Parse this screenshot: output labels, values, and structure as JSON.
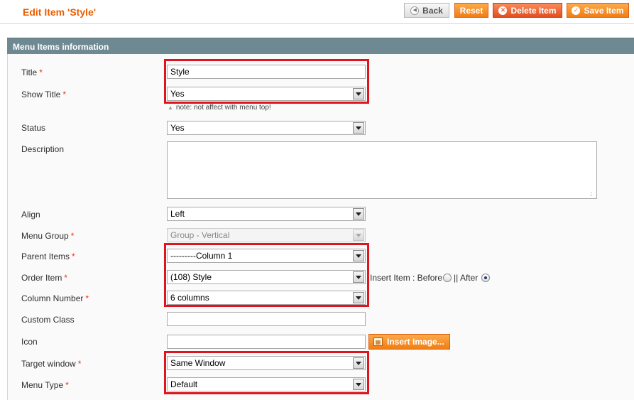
{
  "header": {
    "title": "Edit Item 'Style'",
    "buttons": {
      "back": "Back",
      "reset": "Reset",
      "delete": "Delete Item",
      "save": "Save Item"
    }
  },
  "section": {
    "title": "Menu Items information"
  },
  "form": {
    "title": {
      "label": "Title",
      "required": "*",
      "value": "Style"
    },
    "show_title": {
      "label": "Show Title",
      "required": "*",
      "value": "Yes",
      "note": "note: not affect with menu top!"
    },
    "status": {
      "label": "Status",
      "value": "Yes"
    },
    "description": {
      "label": "Description",
      "value": ""
    },
    "align": {
      "label": "Align",
      "value": "Left"
    },
    "menu_group": {
      "label": "Menu Group",
      "required": "*",
      "value": "Group - Vertical",
      "disabled": true
    },
    "parent_items": {
      "label": "Parent Items",
      "required": "*",
      "value": "---------Column 1"
    },
    "order_item": {
      "label": "Order Item",
      "required": "*",
      "value": "(108) Style"
    },
    "insert_item": {
      "label": "Insert Item : Before",
      "after_label": "|| After",
      "selected": "After"
    },
    "column_number": {
      "label": "Column Number",
      "required": "*",
      "value": "6 columns"
    },
    "custom_class": {
      "label": "Custom Class",
      "value": ""
    },
    "icon": {
      "label": "Icon",
      "value": "",
      "button": "Insert Image..."
    },
    "target_window": {
      "label": "Target window",
      "required": "*",
      "value": "Same Window"
    },
    "menu_type": {
      "label": "Menu Type",
      "required": "*",
      "value": "Default"
    }
  },
  "colors": {
    "title_orange": "#eb5e00",
    "section_header": "#6f8992",
    "highlight_red": "#e0141e",
    "required_asterisk": "#eb340a"
  }
}
